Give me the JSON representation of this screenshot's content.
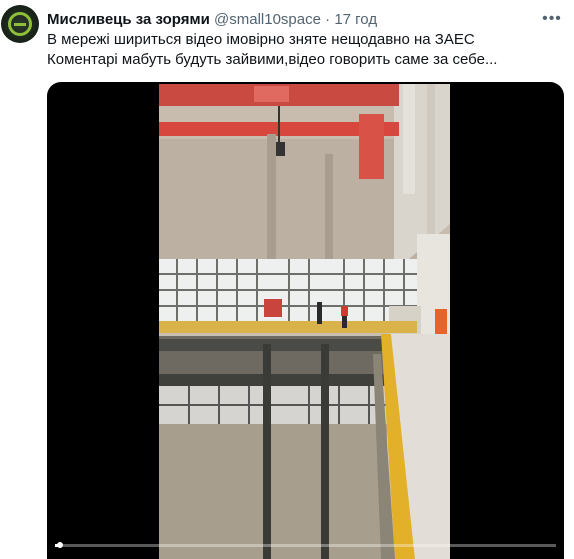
{
  "tweet": {
    "author_name": "Мисливець за зорями",
    "author_handle": "@small10space",
    "separator": "·",
    "time": "17 год",
    "more_icon": "more-horizontal-icon",
    "text_lines": [
      "В мережі шириться відео імовірно зняте нещодавно на ЗАЕС",
      "Коментарі мабуть будуть зайвими,відео говорить саме за себе..."
    ]
  },
  "video": {
    "progress": 0.01
  },
  "colors": {
    "text_primary": "#0f1419",
    "text_secondary": "#536471",
    "video_bg": "#000000",
    "crane_red": "#d7473e",
    "railing_yellow": "#e3b02a",
    "floor_orange": "#e8632a"
  }
}
